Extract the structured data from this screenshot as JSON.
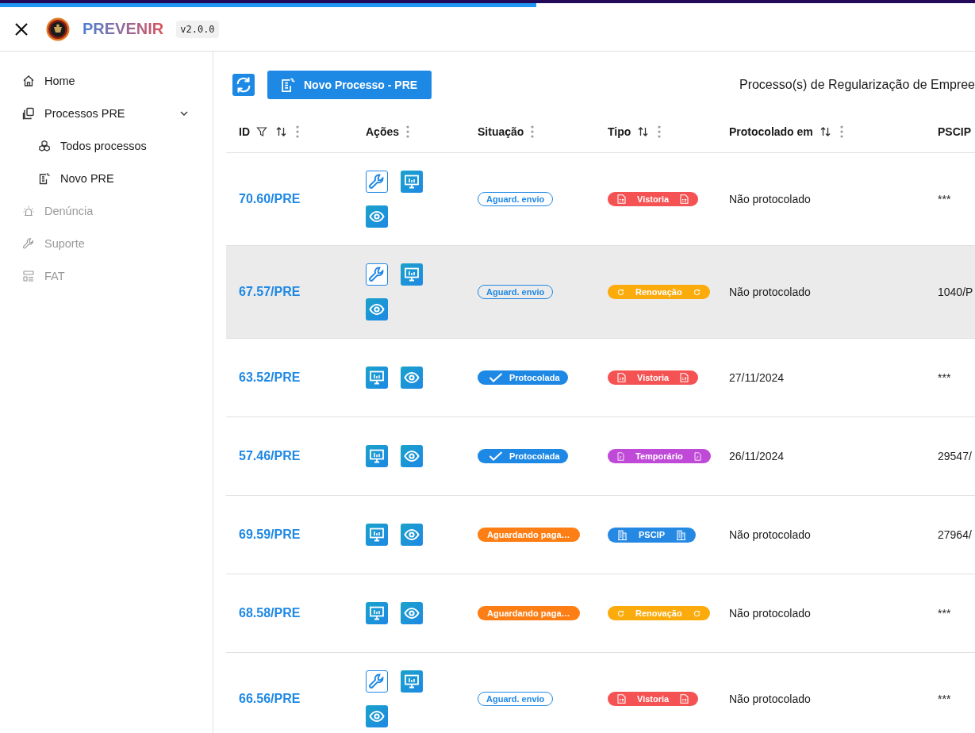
{
  "progress": {
    "level": 0.55
  },
  "header": {
    "title": "PREVENIR",
    "version": "v2.0.0"
  },
  "sidebar": {
    "items": [
      {
        "label": "Home",
        "kind": "home",
        "disabled": false
      },
      {
        "label": "Processos PRE",
        "kind": "docs",
        "disabled": false,
        "expanded": true,
        "children": [
          {
            "label": "Todos processos",
            "kind": "cubes",
            "disabled": false
          },
          {
            "label": "Novo PRE",
            "kind": "newdoc",
            "disabled": false
          }
        ]
      },
      {
        "label": "Denúncia",
        "kind": "siren",
        "disabled": true
      },
      {
        "label": "Suporte",
        "kind": "wrench",
        "disabled": true
      },
      {
        "label": "FAT",
        "kind": "form",
        "disabled": true
      }
    ]
  },
  "toolbar": {
    "new_button": "Novo Processo - PRE",
    "heading": "Processo(s) de Regularização de Empree"
  },
  "table": {
    "columns": [
      {
        "label": "ID",
        "filter": true,
        "sort": true,
        "menu": true
      },
      {
        "label": "Ações",
        "filter": false,
        "sort": false,
        "menu": true
      },
      {
        "label": "Situação",
        "filter": false,
        "sort": false,
        "menu": true
      },
      {
        "label": "Tipo",
        "filter": false,
        "sort": true,
        "menu": true
      },
      {
        "label": "Protocolado em",
        "filter": false,
        "sort": true,
        "menu": true
      },
      {
        "label": "PSCIP",
        "filter": false,
        "sort": false,
        "menu": false
      }
    ],
    "rows": [
      {
        "id": "70.60/PRE",
        "selected": false,
        "actions": [
          {
            "kind": "edit"
          },
          {
            "kind": "report"
          },
          {
            "kind": "view"
          }
        ],
        "status": {
          "label": "Aguard. envio",
          "kind": "outline"
        },
        "type": {
          "label": "Vistoria",
          "kind": "file",
          "color": "#f55353"
        },
        "protocol": "Não protocolado",
        "pscip": "***"
      },
      {
        "id": "67.57/PRE",
        "selected": true,
        "actions": [
          {
            "kind": "edit"
          },
          {
            "kind": "report"
          },
          {
            "kind": "view"
          }
        ],
        "status": {
          "label": "Aguard. envio",
          "kind": "outline"
        },
        "type": {
          "label": "Renovação",
          "kind": "refresh",
          "color": "#fbab0b"
        },
        "protocol": "Não protocolado",
        "pscip": "1040/P"
      },
      {
        "id": "63.52/PRE",
        "selected": false,
        "actions": [
          {
            "kind": "report"
          },
          {
            "kind": "view"
          }
        ],
        "status": {
          "label": "Protocolada",
          "kind": "done"
        },
        "type": {
          "label": "Vistoria",
          "kind": "file",
          "color": "#f55353"
        },
        "protocol": "27/11/2024",
        "pscip": "***"
      },
      {
        "id": "57.46/PRE",
        "selected": false,
        "actions": [
          {
            "kind": "report"
          },
          {
            "kind": "view"
          }
        ],
        "status": {
          "label": "Protocolada",
          "kind": "done"
        },
        "type": {
          "label": "Temporário",
          "kind": "doc",
          "color": "#c04ad8"
        },
        "protocol": "26/11/2024",
        "pscip": "29547/"
      },
      {
        "id": "69.59/PRE",
        "selected": false,
        "actions": [
          {
            "kind": "report"
          },
          {
            "kind": "view"
          }
        ],
        "status": {
          "label": "Aguardando paga…",
          "kind": "pending"
        },
        "type": {
          "label": "PSCIP",
          "kind": "building",
          "color": "#2589e4"
        },
        "protocol": "Não protocolado",
        "pscip": "27964/"
      },
      {
        "id": "68.58/PRE",
        "selected": false,
        "actions": [
          {
            "kind": "report"
          },
          {
            "kind": "view"
          }
        ],
        "status": {
          "label": "Aguardando paga…",
          "kind": "pending"
        },
        "type": {
          "label": "Renovação",
          "kind": "refresh",
          "color": "#fbab0b"
        },
        "protocol": "Não protocolado",
        "pscip": "***"
      },
      {
        "id": "66.56/PRE",
        "selected": false,
        "actions": [
          {
            "kind": "edit"
          },
          {
            "kind": "report"
          },
          {
            "kind": "view"
          }
        ],
        "status": {
          "label": "Aguard. envio",
          "kind": "outline"
        },
        "type": {
          "label": "Vistoria",
          "kind": "file",
          "color": "#f55353"
        },
        "protocol": "Não protocolado",
        "pscip": "***"
      }
    ]
  }
}
